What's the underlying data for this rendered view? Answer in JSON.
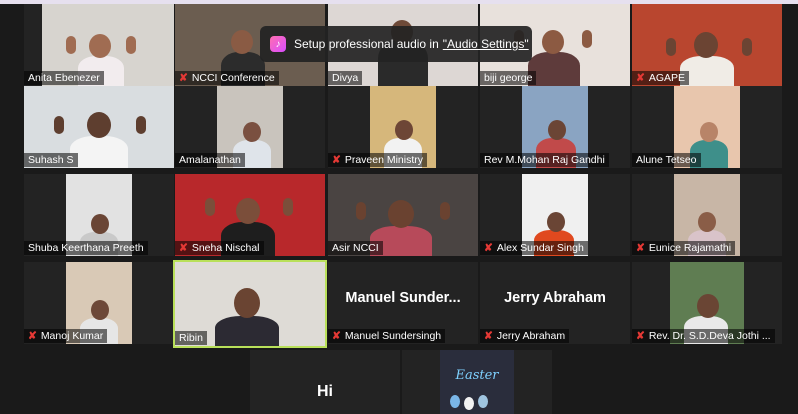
{
  "toast": {
    "message": "Setup professional audio in",
    "link": "\"Audio Settings\"",
    "icon": "music-note-icon"
  },
  "participants": [
    {
      "name": "Anita Ebenezer",
      "muted": false
    },
    {
      "name": "NCCI Conference",
      "muted": true
    },
    {
      "name": "Divya",
      "muted": false
    },
    {
      "name": "biji george",
      "muted": false
    },
    {
      "name": "AGAPE",
      "muted": true
    },
    {
      "name": "Suhash S",
      "muted": false
    },
    {
      "name": "Amalanathan",
      "muted": false
    },
    {
      "name": "Praveen Ministry",
      "muted": true
    },
    {
      "name": "Rev  M.Mohan Raj Gandhi",
      "muted": false
    },
    {
      "name": "Alune Tetseo",
      "muted": false
    },
    {
      "name": "Shuba Keerthana Preeth",
      "muted": false
    },
    {
      "name": "Sneha Nischal",
      "muted": true
    },
    {
      "name": "Asir NCCI",
      "muted": false
    },
    {
      "name": "Alex Sundar Singh",
      "muted": true
    },
    {
      "name": "Eunice Rajamathi",
      "muted": true
    },
    {
      "name": "Manoj Kumar",
      "muted": true
    },
    {
      "name": "Ribin",
      "muted": false
    },
    {
      "name": "Manuel Sundersingh",
      "muted": true,
      "display": "Manuel  Sunder..."
    },
    {
      "name": "Jerry Abraham",
      "muted": true,
      "display": "Jerry Abraham"
    },
    {
      "name": "Rev. Dr. S.D.Deva Jothi ...",
      "muted": true
    }
  ],
  "bottom_tiles": [
    {
      "label": "Hi"
    },
    {
      "label": "Easter"
    }
  ],
  "mute_symbol": "✘",
  "colors": {
    "active_speaker": "#b9e05a",
    "muted_icon": "#e53935"
  }
}
